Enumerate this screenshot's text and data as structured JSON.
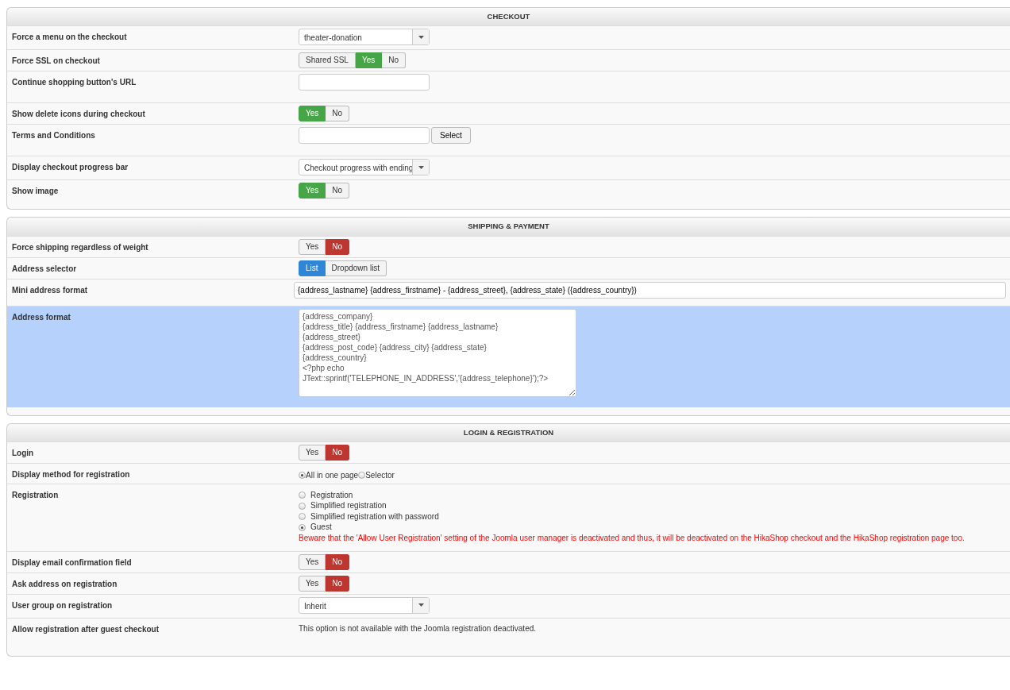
{
  "panels": [
    {
      "title": "CHECKOUT",
      "rows": [
        {
          "label": "Force a menu on the checkout",
          "kind": "select",
          "value": "theater-donation",
          "highlighted": false
        },
        {
          "label": "Force SSL on checkout",
          "kind": "toggle",
          "options": [
            {
              "label": "Shared SSL",
              "selected": false,
              "color": "#f3f3f3"
            },
            {
              "label": "Yes",
              "selected": true,
              "color": "#46a546"
            },
            {
              "label": "No",
              "selected": false,
              "color": "#f3f3f3"
            }
          ],
          "highlighted": false
        },
        {
          "label": "Continue shopping button's URL",
          "kind": "text",
          "highlighted": false
        },
        {
          "label": "Show delete icons during checkout",
          "kind": "toggle",
          "options": [
            {
              "label": "Yes",
              "selected": true,
              "color": "#46a546"
            },
            {
              "label": "No",
              "selected": false,
              "color": "#f3f3f3"
            }
          ],
          "highlighted": false
        },
        {
          "label": "Terms and Conditions",
          "kind": "text_button",
          "button": "Select",
          "highlighted": false
        },
        {
          "label": "Display checkout progress bar",
          "kind": "select",
          "value": "Checkout progress with ending",
          "highlighted": false
        },
        {
          "label": "Show image",
          "kind": "toggle",
          "options": [
            {
              "label": "Yes",
              "selected": true,
              "color": "#46a546"
            },
            {
              "label": "No",
              "selected": false,
              "color": "#f3f3f3"
            }
          ],
          "highlighted": false
        }
      ]
    },
    {
      "title": "SHIPPING & PAYMENT",
      "rows": [
        {
          "label": "Force shipping regardless of weight",
          "kind": "toggle",
          "options": [
            {
              "label": "Yes",
              "selected": false,
              "color": "#f3f3f3"
            },
            {
              "label": "No",
              "selected": true,
              "color": "#bd362f"
            }
          ],
          "highlighted": false
        },
        {
          "label": "Address selector",
          "kind": "toggle",
          "options": [
            {
              "label": "List",
              "selected": true,
              "color": "#2f86d6"
            },
            {
              "label": "Dropdown list",
              "selected": false,
              "color": "#f3f3f3"
            }
          ],
          "highlighted": false
        },
        {
          "label": "Mini address format",
          "kind": "wide_text",
          "value": "{address_lastname} {address_firstname} - {address_street}, {address_state} ({address_country})",
          "highlighted": false
        },
        {
          "label": "Address format",
          "kind": "textarea",
          "value": "{address_company}\n{address_title} {address_firstname} {address_lastname}\n{address_street}\n{address_post_code} {address_city} {address_state}\n{address_country}\n<?php echo JText::sprintf('TELEPHONE_IN_ADDRESS','{address_telephone}');?>",
          "highlighted": true
        }
      ]
    },
    {
      "title": "LOGIN & REGISTRATION",
      "rows": [
        {
          "label": "Login",
          "kind": "toggle",
          "options": [
            {
              "label": "Yes",
              "selected": false,
              "color": "#f3f3f3"
            },
            {
              "label": "No",
              "selected": true,
              "color": "#bd362f"
            }
          ],
          "highlighted": false
        },
        {
          "label": "Display method for registration",
          "kind": "radio_inline",
          "options": [
            {
              "label": "All in one page",
              "selected": true
            },
            {
              "label": "Selector",
              "selected": false
            }
          ],
          "highlighted": false
        },
        {
          "label": "Registration",
          "kind": "radio_list",
          "options": [
            {
              "label": "Registration",
              "selected": false
            },
            {
              "label": "Simplified registration",
              "selected": false
            },
            {
              "label": "Simplified registration with password",
              "selected": false
            },
            {
              "label": "Guest",
              "selected": true
            }
          ],
          "warning": "Beware that the 'Allow User Registration' setting of the Joomla user manager is deactivated and thus, it will be deactivated on the HikaShop checkout and the HikaShop registration page too.",
          "highlighted": false
        },
        {
          "label": "Display email confirmation field",
          "kind": "toggle",
          "options": [
            {
              "label": "Yes",
              "selected": false,
              "color": "#f3f3f3"
            },
            {
              "label": "No",
              "selected": true,
              "color": "#bd362f"
            }
          ],
          "highlighted": false
        },
        {
          "label": "Ask address on registration",
          "kind": "toggle",
          "options": [
            {
              "label": "Yes",
              "selected": false,
              "color": "#f3f3f3"
            },
            {
              "label": "No",
              "selected": true,
              "color": "#bd362f"
            }
          ],
          "highlighted": false
        },
        {
          "label": "User group on registration",
          "kind": "select",
          "value": "Inherit",
          "highlighted": false
        },
        {
          "label": "Allow registration after guest checkout",
          "kind": "note",
          "value": "This option is not available with the Joomla registration deactivated.",
          "highlighted": false
        }
      ]
    }
  ]
}
